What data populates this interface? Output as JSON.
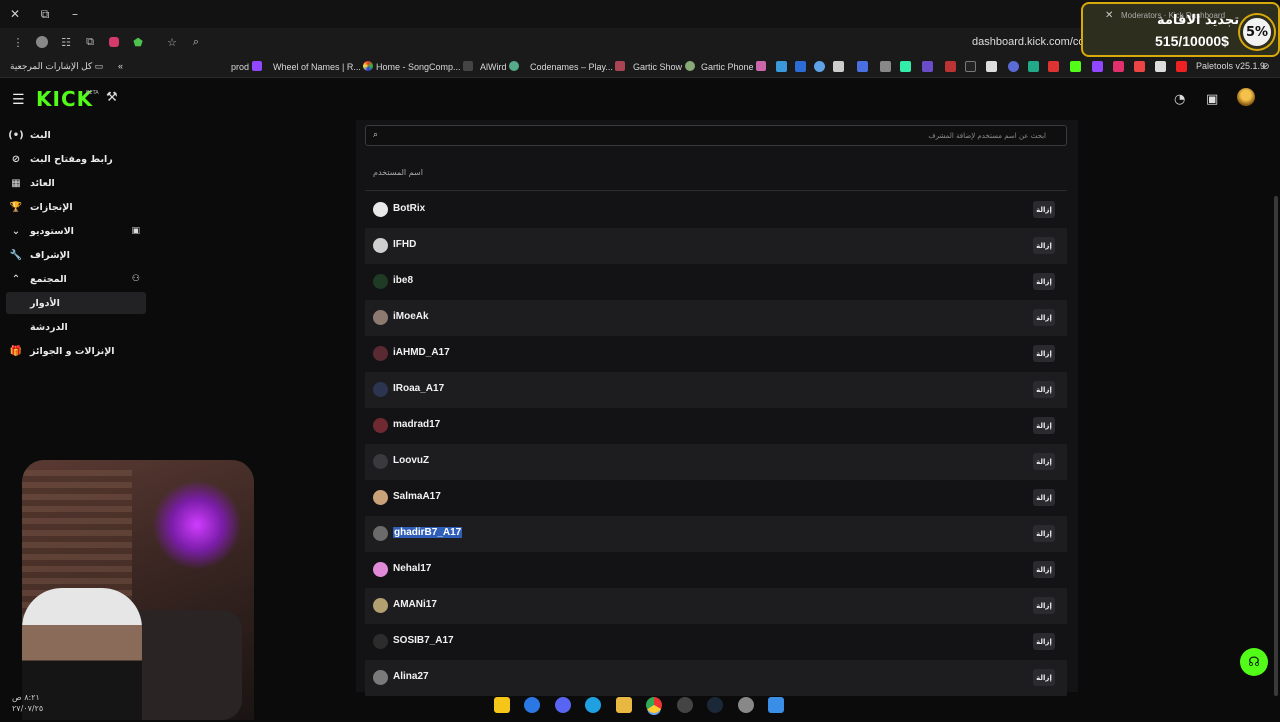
{
  "window": {
    "controls": [
      "✕",
      "⧉",
      "–"
    ]
  },
  "browser": {
    "url": "dashboard.kick.com/community/roles/moderators",
    "bookmarks": {
      "all_bookmarks": "كل الإشارات المرجعية",
      "items": [
        "prod",
        "Wheel of Names | R...",
        "Home - SongComp...",
        "AlWird",
        "Codenames – Play...",
        "Gartic Show",
        "Gartic Phone",
        "Paletools v25.1.9"
      ]
    },
    "popup": {
      "small_text": "Moderators · Kick Dashboard",
      "title": "تجديد الاقامة",
      "amount": "515/10000$",
      "percent": "5%"
    }
  },
  "header": {
    "logo": "KICK",
    "logo_badge": "BETA"
  },
  "sidebar": {
    "items": [
      {
        "label": "البث",
        "icon": "(•)"
      },
      {
        "label": "رابط ومفتاح البث",
        "icon": "⊘"
      },
      {
        "label": "العائد",
        "icon": "▦"
      },
      {
        "label": "الإنجازات",
        "icon": "🏆"
      },
      {
        "label": "الاستوديو",
        "icon": "⌄"
      },
      {
        "label": "الإشراف",
        "icon": "🔧"
      },
      {
        "label": "المجتمع",
        "icon": "⌃"
      },
      {
        "label": "الأدوار",
        "icon": ""
      },
      {
        "label": "الدردشة",
        "icon": ""
      },
      {
        "label": "الإنزالات و الجوائز",
        "icon": "🎁"
      }
    ]
  },
  "search": {
    "placeholder": "ابحث عن اسم مستخدم لإضافة المشرف"
  },
  "table": {
    "column_header": "اسم المستخدم",
    "remove_label": "إزالة",
    "rows": [
      {
        "name": "BotRix",
        "avatar_color": "#e8e8e8"
      },
      {
        "name": "IFHD",
        "avatar_color": "#cfcfcf"
      },
      {
        "name": "ibe8",
        "avatar_color": "#1f3a25"
      },
      {
        "name": "iMoeAk",
        "avatar_color": "#8c7a70"
      },
      {
        "name": "iAHMD_A17",
        "avatar_color": "#5a2a32"
      },
      {
        "name": "IRoaa_A17",
        "avatar_color": "#2c3550"
      },
      {
        "name": "madrad17",
        "avatar_color": "#6e2a30"
      },
      {
        "name": "LoovuZ",
        "avatar_color": "#3a3a3e"
      },
      {
        "name": "SalmaA17",
        "avatar_color": "#c9a27a"
      },
      {
        "name": "ghadirB7_A17",
        "avatar_color": "#6b6b6b"
      },
      {
        "name": "Nehal17",
        "avatar_color": "#e08ad8"
      },
      {
        "name": "AMANi17",
        "avatar_color": "#b3a070"
      },
      {
        "name": "SOSIB7_A17",
        "avatar_color": "#2c2c2c"
      },
      {
        "name": "Alina27",
        "avatar_color": "#7a7a7a"
      }
    ]
  },
  "taskbar": {
    "clock_time": "٨:٢١ ص",
    "clock_date": "٢٧/٠٧/٢٥"
  },
  "colors": {
    "brand": "#53fc18",
    "selection": "#2f5fb8",
    "popup_border": "#d8a90a"
  }
}
